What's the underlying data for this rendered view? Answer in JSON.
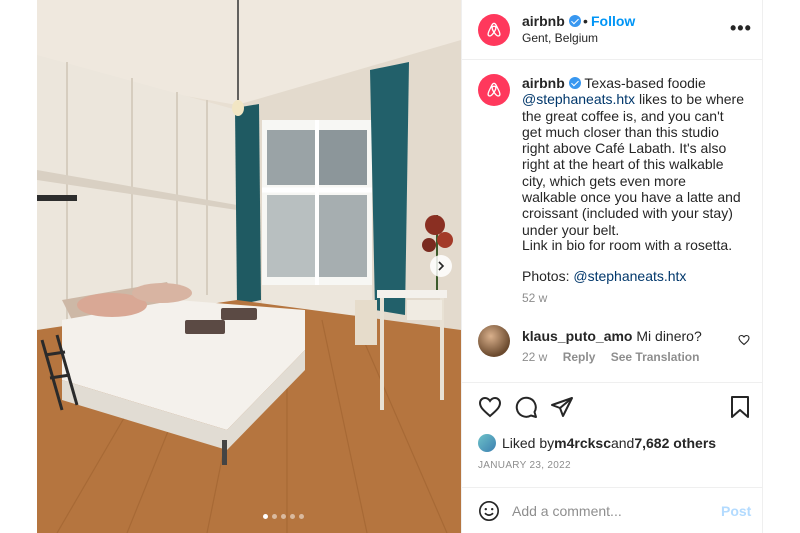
{
  "post": {
    "username": "airbnb",
    "separator": "•",
    "follow_label": "Follow",
    "location": "Gent, Belgium",
    "more_label": "•••",
    "brand_color": "#ff385c",
    "link_color": "#0095f6"
  },
  "caption": {
    "username": "airbnb",
    "text_1": " Texas-based foodie ",
    "mention_1": "@stephaneats.htx",
    "text_2": " likes to be where the great coffee is, and you can't get much closer than this studio right above Café Labath. It's also right at the heart of this walkable city, which gets even more walkable once you have a latte and croissant (included with your stay) under your belt.",
    "paragraph_2": "Link in bio for room with a rosetta.",
    "photos_prefix": "Photos: ",
    "photos_mention": "@stephaneats.htx",
    "timestamp": "52 w"
  },
  "comment": {
    "username": "klaus_puto_amo",
    "text": " Mi dinero?",
    "time": "22 w",
    "reply_label": "Reply",
    "translate_label": "See Translation"
  },
  "likes": {
    "prefix": "Liked by ",
    "user": "m4rcksc",
    "and": " and ",
    "others": "7,682 others"
  },
  "date": "JANUARY 23, 2022",
  "comment_box": {
    "placeholder": "Add a comment...",
    "post_label": "Post"
  },
  "carousel": {
    "total_slides": 5,
    "active_slide": 1
  },
  "icons": [
    "airbnb-logo-icon",
    "verified-badge-icon",
    "more-options-icon",
    "heart-icon",
    "comment-icon",
    "share-icon",
    "save-icon",
    "emoji-icon",
    "chevron-right-icon"
  ]
}
